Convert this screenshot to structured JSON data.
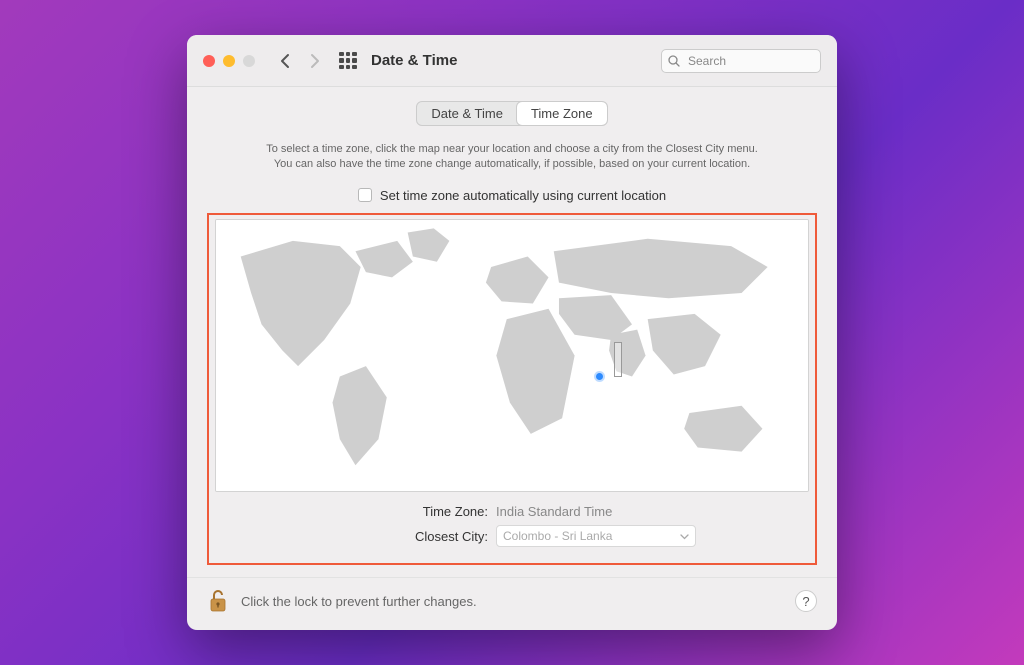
{
  "window": {
    "title": "Date & Time"
  },
  "search": {
    "placeholder": "Search"
  },
  "tabs": {
    "date_time": "Date & Time",
    "time_zone": "Time Zone"
  },
  "instructions": {
    "line1": "To select a time zone, click the map near your location and choose a city from the Closest City menu.",
    "line2": "You can also have the time zone change automatically, if possible, based on your current location."
  },
  "checkbox": {
    "label": "Set time zone automatically using current location"
  },
  "timezone": {
    "label": "Time Zone:",
    "value": "India Standard Time"
  },
  "closest_city": {
    "label": "Closest City:",
    "value": "Colombo - Sri Lanka"
  },
  "footer": {
    "lock_text": "Click the lock to prevent further changes.",
    "help": "?"
  }
}
